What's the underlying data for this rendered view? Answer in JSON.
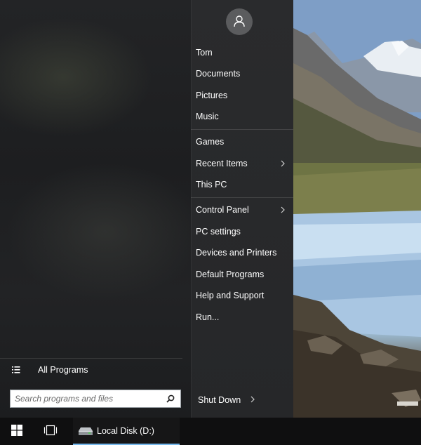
{
  "start_menu": {
    "user": {
      "name": "Tom",
      "avatar_icon": "user-icon"
    },
    "items": [
      {
        "label": "Tom",
        "has_submenu": false
      },
      {
        "label": "Documents",
        "has_submenu": false
      },
      {
        "label": "Pictures",
        "has_submenu": false
      },
      {
        "label": "Music",
        "has_submenu": false
      },
      {
        "label": "Games",
        "has_submenu": false
      },
      {
        "label": "Recent Items",
        "has_submenu": true
      },
      {
        "label": "This PC",
        "has_submenu": false
      },
      {
        "label": "Control Panel",
        "has_submenu": true
      },
      {
        "label": "PC settings",
        "has_submenu": false
      },
      {
        "label": "Devices and Printers",
        "has_submenu": false
      },
      {
        "label": "Default Programs",
        "has_submenu": false
      },
      {
        "label": "Help and Support",
        "has_submenu": false
      },
      {
        "label": "Run...",
        "has_submenu": false
      }
    ],
    "all_programs": {
      "label": "All Programs",
      "icon": "list-icon"
    },
    "search": {
      "placeholder": "Search programs and files",
      "value": "",
      "icon": "search-icon"
    },
    "shutdown": {
      "label": "Shut Down",
      "icon": "chevron-right-icon"
    }
  },
  "taskbar": {
    "start_icon": "windows-logo-icon",
    "task_view_icon": "task-view-icon",
    "items": [
      {
        "label": "Local Disk (D:)",
        "icon": "drive-icon",
        "active": true
      }
    ],
    "active_indicator_color": "#76b9ed"
  }
}
